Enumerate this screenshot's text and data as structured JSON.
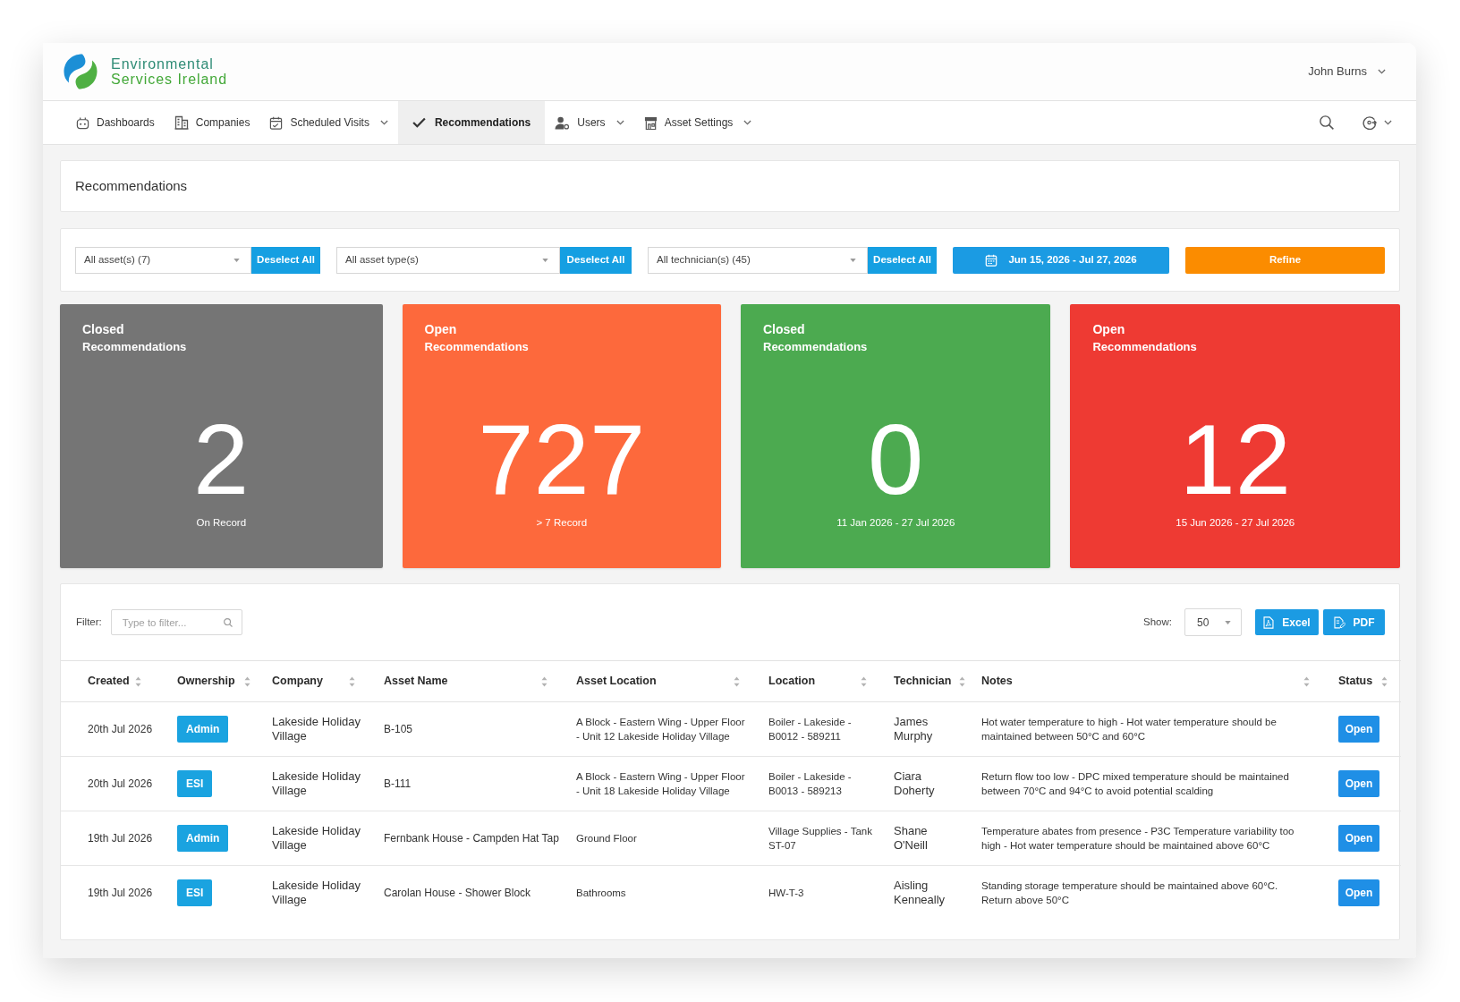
{
  "header": {
    "brand": {
      "line_1": "Environmental",
      "line_2": "Services Ireland"
    },
    "user_menu": "John Burns"
  },
  "nav": {
    "items": [
      {
        "label": "Dashboards",
        "selected": false,
        "dropdown": false
      },
      {
        "label": "Companies",
        "selected": false,
        "dropdown": false
      },
      {
        "label": "Scheduled Visits",
        "selected": false,
        "dropdown": true
      },
      {
        "label": "Recommendations",
        "selected": true,
        "dropdown": false
      },
      {
        "label": "Users",
        "selected": false,
        "dropdown": true
      },
      {
        "label": "Asset Settings",
        "selected": false,
        "dropdown": true
      }
    ]
  },
  "page_title": "Recommendations",
  "filters": {
    "selects": [
      {
        "value": "All asset(s) (7)",
        "button": "Deselect All"
      },
      {
        "value": "All asset type(s)",
        "button": "Deselect All"
      },
      {
        "value": "All technician(s) (45)",
        "button": "Deselect All"
      }
    ],
    "date_range": "Jun 15, 2026 - Jul 27, 2026",
    "refine_button": "Refine"
  },
  "summary_cards": [
    {
      "status": "Closed",
      "label": "Recommendations",
      "value": "2",
      "caption": "On Record",
      "color": "#757575"
    },
    {
      "status": "Open",
      "label": "Recommendations",
      "value": "727",
      "caption": "> 7 Record",
      "color": "#fd693c"
    },
    {
      "status": "Closed",
      "label": "Recommendations",
      "value": "0",
      "caption": "11 Jan 2026 - 27 Jul 2026",
      "color": "#4caa50"
    },
    {
      "status": "Open",
      "label": "Recommendations",
      "value": "12",
      "caption": "15 Jun 2026 - 27 Jul 2026",
      "color": "#ee3a33"
    }
  ],
  "table": {
    "filter": {
      "label": "Filter:",
      "placeholder": "Type to filter..."
    },
    "page_size": {
      "label": "Show:",
      "value": "50"
    },
    "export_buttons": [
      "Excel",
      "PDF"
    ],
    "columns": [
      {
        "label": "Created",
        "sortable": true,
        "kind": "text"
      },
      {
        "label": "Ownership",
        "sortable": true,
        "kind": "badge"
      },
      {
        "label": "Company",
        "sortable": true,
        "kind": "text"
      },
      {
        "label": "Asset Name",
        "sortable": true,
        "kind": "text"
      },
      {
        "label": "Asset Location",
        "sortable": true,
        "kind": "text"
      },
      {
        "label": "Location",
        "sortable": true,
        "kind": "text"
      },
      {
        "label": "Technician",
        "sortable": true,
        "kind": "text"
      },
      {
        "label": "Notes",
        "sortable": true,
        "kind": "text"
      },
      {
        "label": "Status",
        "sortable": true,
        "kind": "button"
      }
    ],
    "rows": [
      {
        "cells": [
          "20th Jul 2026",
          "Admin",
          "Lakeside Holiday Village",
          "B-105",
          "A Block - Eastern Wing - Upper Floor - Unit 12 Lakeside Holiday Village",
          "Boiler - Lakeside - B0012 - 589211",
          "James Murphy",
          "Hot water temperature to high - Hot water temperature should be maintained between 50°C and 60°C",
          "Open"
        ]
      },
      {
        "cells": [
          "20th Jul 2026",
          "ESI",
          "Lakeside Holiday Village",
          "B-111",
          "A Block - Eastern Wing - Upper Floor - Unit 18 Lakeside Holiday Village",
          "Boiler - Lakeside - B0013 - 589213",
          "Ciara Doherty",
          "Return flow too low - DPC mixed temperature should be maintained between 70°C and 94°C to avoid potential scalding",
          "Open"
        ]
      },
      {
        "cells": [
          "19th Jul 2026",
          "Admin",
          "Lakeside Holiday Village",
          "Fernbank House - Campden Hat Tap",
          "Ground Floor",
          "Village Supplies - Tank ST-07",
          "Shane O'Neill",
          "Temperature abates from presence - P3C Temperature variability too high - Hot water temperature should be maintained above 60°C",
          "Open"
        ]
      },
      {
        "cells": [
          "19th Jul 2026",
          "ESI",
          "Lakeside Holiday Village",
          "Carolan House - Shower Block",
          "Bathrooms",
          "HW-T-3",
          "Aisling Kenneally",
          "Standing storage temperature should be maintained above 60°C. Return above 50°C",
          "Open"
        ]
      }
    ]
  }
}
